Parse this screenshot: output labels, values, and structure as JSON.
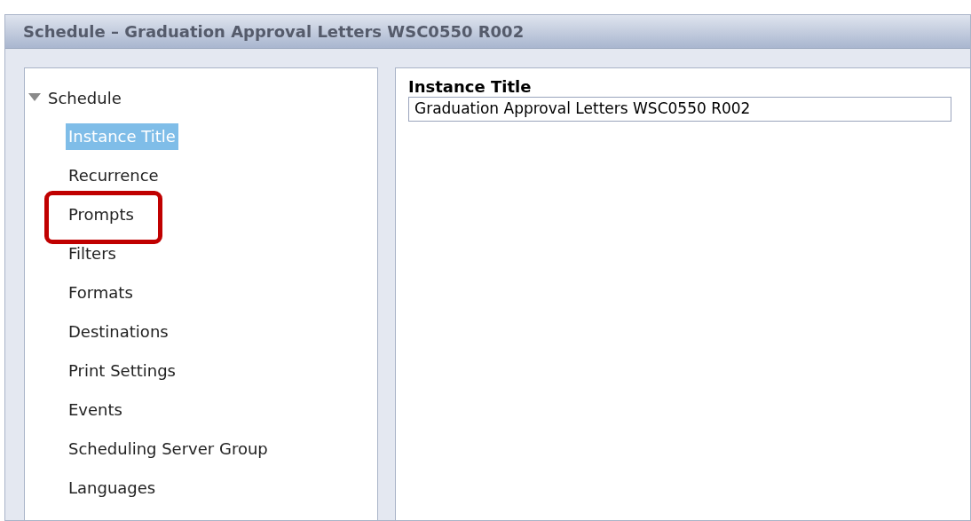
{
  "window": {
    "title": "Schedule – Graduation Approval Letters WSC0550 R002"
  },
  "tree": {
    "label": "Schedule",
    "expanded": true,
    "children": [
      {
        "label": "Instance Title",
        "selected": true,
        "highlighted": false
      },
      {
        "label": "Recurrence",
        "selected": false,
        "highlighted": false
      },
      {
        "label": "Prompts",
        "selected": false,
        "highlighted": true
      },
      {
        "label": "Filters",
        "selected": false,
        "highlighted": false
      },
      {
        "label": "Formats",
        "selected": false,
        "highlighted": false
      },
      {
        "label": "Destinations",
        "selected": false,
        "highlighted": false
      },
      {
        "label": "Print Settings",
        "selected": false,
        "highlighted": false
      },
      {
        "label": "Events",
        "selected": false,
        "highlighted": false
      },
      {
        "label": "Scheduling Server Group",
        "selected": false,
        "highlighted": false
      },
      {
        "label": "Languages",
        "selected": false,
        "highlighted": false
      }
    ]
  },
  "form": {
    "label": "Instance Title",
    "value": "Graduation Approval Letters WSC0550 R002"
  }
}
